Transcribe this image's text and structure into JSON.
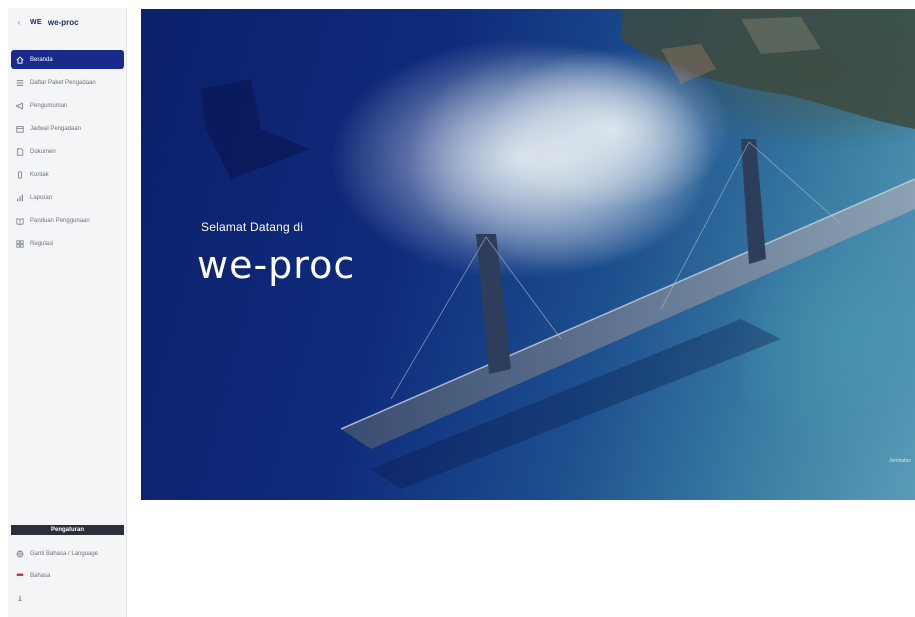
{
  "brand": {
    "logo_mark": "WE",
    "name": "we-proc"
  },
  "sidebar": {
    "items": [
      {
        "label": "Beranda",
        "icon": "home-icon",
        "active": true
      },
      {
        "label": "Daftar Paket Pengadaan",
        "icon": "list-icon",
        "active": false
      },
      {
        "label": "Pengumuman",
        "icon": "megaphone-icon",
        "active": false
      },
      {
        "label": "Jadwal Pengadaan",
        "icon": "calendar-icon",
        "active": false
      },
      {
        "label": "Dokumen",
        "icon": "document-icon",
        "active": false
      },
      {
        "label": "Kontak",
        "icon": "phone-icon",
        "active": false
      },
      {
        "label": "Laporan",
        "icon": "chart-icon",
        "active": false
      },
      {
        "label": "Panduan Penggunaan",
        "icon": "book-icon",
        "active": false
      },
      {
        "label": "Regulasi",
        "icon": "grid-icon",
        "active": false
      }
    ],
    "section_title": "Pengaturan",
    "lower_items": [
      {
        "label": "Ganti Bahasa / Language",
        "icon": "language-icon"
      },
      {
        "label": "Bahasa",
        "icon": "flag-icon"
      },
      {
        "label": "",
        "icon": "info-icon"
      }
    ]
  },
  "hero": {
    "welcome": "Selamat Datang di",
    "wordmark": "we-proc",
    "credit": "Jembatan"
  },
  "colors": {
    "active_bg": "#1a2a8a",
    "brand": "#1e2b6e",
    "hero_deep": "#0b1f6a",
    "hero_light": "#5a9bb7"
  }
}
